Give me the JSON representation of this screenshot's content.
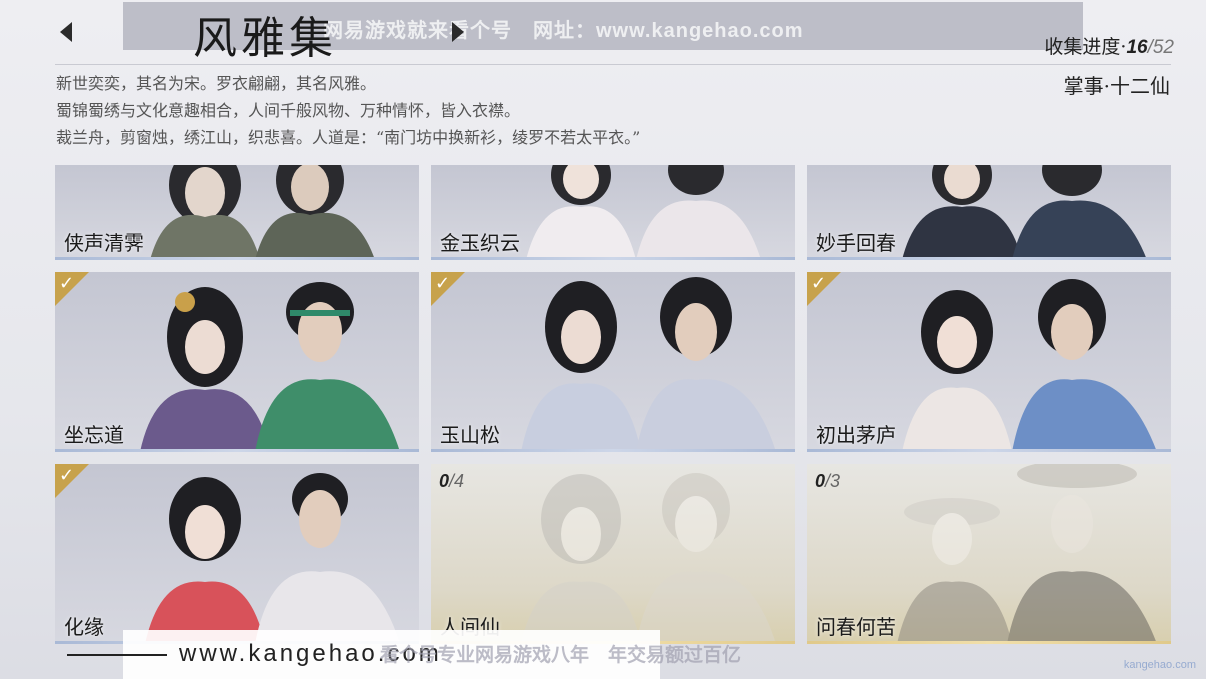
{
  "header": {
    "title": "风雅集",
    "watermark": "网易游戏就来看个号　网址：www.kangehao.com",
    "progress_label": "收集进度·",
    "progress_current": "16",
    "progress_total": "/52",
    "manager": "掌事·十二仙"
  },
  "description": [
    "新世奕奕，其名为宋。罗衣翩翩，其名风雅。",
    "蜀锦蜀绣与文化意趣相合，人间千般风物、万种情怀，皆入衣襟。",
    "裁兰舟，剪窗烛，绣江山，织悲喜。人道是：“南门坊中换新衫，绫罗不若太平衣。”"
  ],
  "cards": [
    {
      "label": "侠声清霁"
    },
    {
      "label": "金玉织云"
    },
    {
      "label": "妙手回春"
    },
    {
      "label": "坐忘道"
    },
    {
      "label": "玉山松"
    },
    {
      "label": "初出茅庐"
    },
    {
      "label": "化缘"
    },
    {
      "label": "人间仙",
      "count_current": "0",
      "count_total": "/4"
    },
    {
      "label": "问春何苦",
      "count_current": "0",
      "count_total": "/3"
    }
  ],
  "bottom": {
    "url": "www.kangehao.com",
    "watermark": "看个号专业网易游戏八年　年交易额过百亿",
    "corner_logo": "kangehao.com"
  },
  "colors": {
    "badge_gold": "#c7a24c",
    "locked_glow": "#e0c98a",
    "owned_glow": "#a9b9d6"
  },
  "icons": {
    "prev": "chevron-left-icon",
    "next": "chevron-right-icon",
    "owned": "check-badge-icon"
  }
}
